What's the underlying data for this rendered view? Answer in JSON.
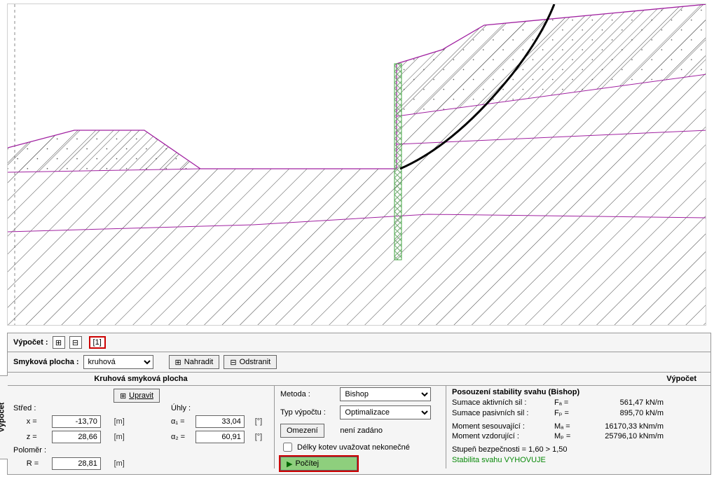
{
  "toolbar": {
    "vypocet_label": "Výpočet :",
    "tab_number": "[1]",
    "plus_icon": "⊞",
    "minus_icon": "⊟"
  },
  "slip": {
    "label": "Smyková plocha :",
    "value": "kruhová",
    "nahradit": "Nahradit",
    "odstranit": "Odstranit"
  },
  "circ": {
    "title": "Kruhová smyková plocha",
    "upravit": "Upravit",
    "stred_label": "Střed :",
    "x_label": "x =",
    "x_val": "-13,70",
    "z_label": "z =",
    "z_val": "28,66",
    "unit_m": "[m]",
    "uhly_label": "Úhly :",
    "a1_label": "α₁ =",
    "a1_val": "33,04",
    "a2_label": "α₂ =",
    "a2_val": "60,91",
    "unit_deg": "[°]",
    "polomer_label": "Poloměr :",
    "R_label": "R =",
    "R_val": "28,81"
  },
  "calc": {
    "metoda_label": "Metoda :",
    "metoda_val": "Bishop",
    "typ_label": "Typ výpočtu :",
    "typ_val": "Optimalizace",
    "omezeni_btn": "Omezení",
    "omezeni_val": "není zadáno",
    "delky": "Délky kotev uvažovat nekonečné",
    "pocitej": "Počítej"
  },
  "results": {
    "header": "Výpočet",
    "title": "Posouzení stability svahu (Bishop)",
    "l1a": "Sumace aktivních sil :",
    "l1s": "Fₐ =",
    "l1v": "561,47 kN/m",
    "l2a": "Sumace pasivních sil :",
    "l2s": "Fₚ =",
    "l2v": "895,70 kN/m",
    "l3a": "Moment sesouvající :",
    "l3s": "Mₐ =",
    "l3v": "16170,33 kNm/m",
    "l4a": "Moment vzdorující :",
    "l4s": "Mₚ =",
    "l4v": "25796,10 kNm/m",
    "sf": "Stupeň bezpečnosti = 1,60 > 1,50",
    "ok": "Stabilita svahu VYHOVUJE"
  },
  "side_tab": "Výpočet"
}
